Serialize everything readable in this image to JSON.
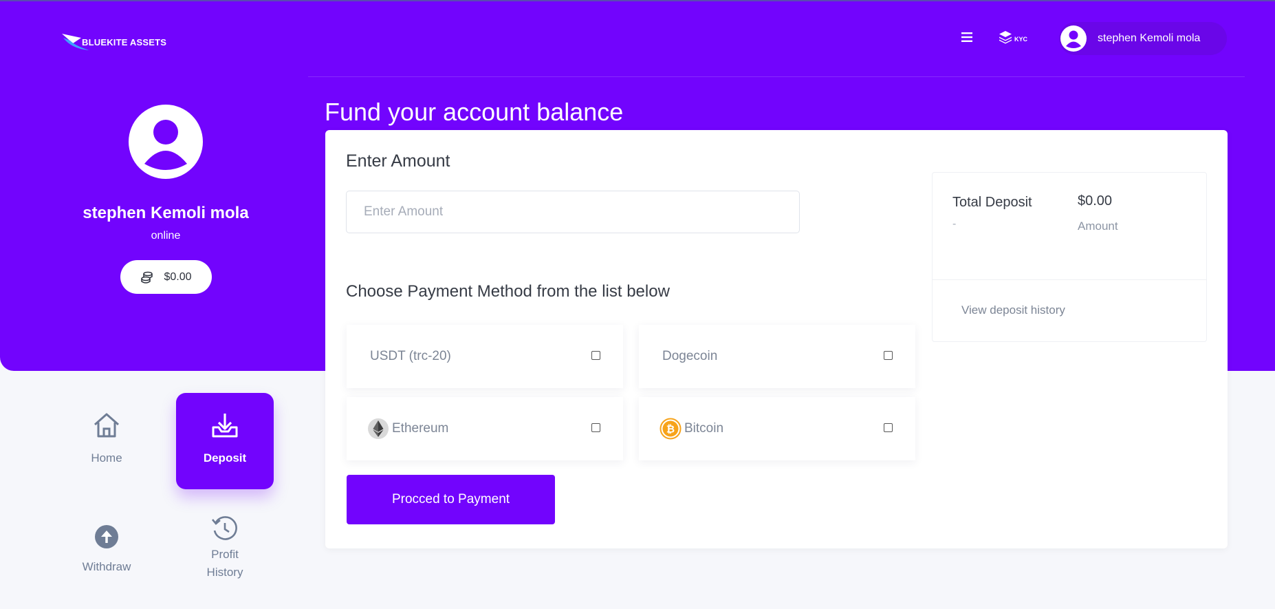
{
  "brand": {
    "name": "BLUEKITE ASSETS"
  },
  "header": {
    "kyc_label": "KYC",
    "user_name": "stephen Kemoli mola"
  },
  "profile": {
    "name": "stephen Kemoli mola",
    "status": "online",
    "balance": "$0.00"
  },
  "nav": {
    "home": "Home",
    "deposit": "Deposit",
    "withdraw": "Withdraw",
    "profit_history": "Profit History"
  },
  "page": {
    "title": "Fund your account balance"
  },
  "form": {
    "amount_title": "Enter Amount",
    "amount_value": "",
    "amount_placeholder": "Enter Amount",
    "method_title": "Choose Payment Method from the list below",
    "methods": [
      {
        "label": "USDT (trc-20)",
        "checked": false
      },
      {
        "label": "Dogecoin",
        "checked": false
      },
      {
        "label": "Ethereum",
        "icon": "ethereum-icon",
        "checked": false
      },
      {
        "label": "Bitcoin",
        "icon": "bitcoin-icon",
        "checked": false
      }
    ],
    "proceed_label": "Procced to Payment"
  },
  "summary": {
    "label": "Total Deposit",
    "dash": "-",
    "value": "$0.00",
    "sub": "Amount",
    "history_link": "View deposit history"
  },
  "colors": {
    "primary": "#7204fd",
    "bitcoin": "#f7a31a",
    "muted_text": "#7c8595"
  }
}
